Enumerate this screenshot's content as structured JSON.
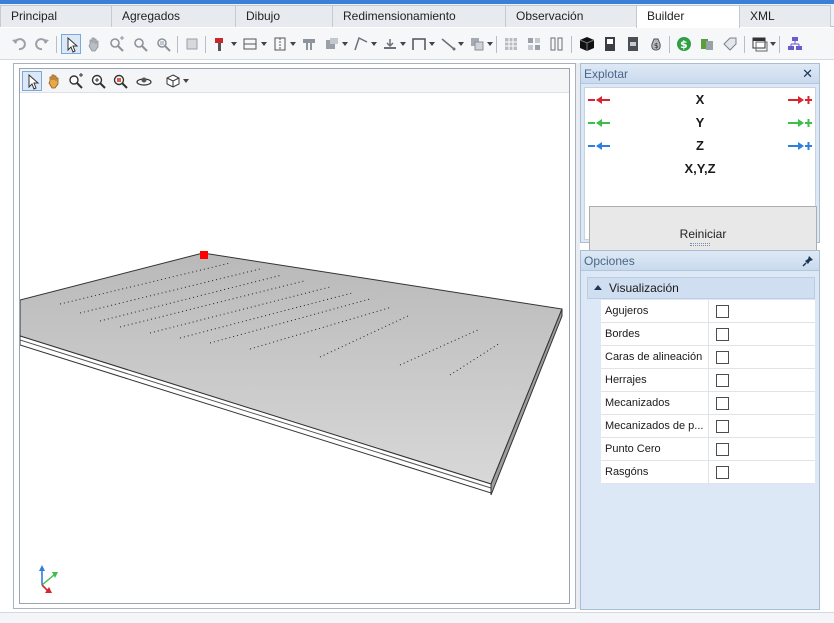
{
  "tabs": [
    {
      "label": "Principal",
      "active": false
    },
    {
      "label": "Agregados",
      "active": false
    },
    {
      "label": "Dibujo",
      "active": false
    },
    {
      "label": "Redimensionamiento",
      "active": false
    },
    {
      "label": "Observación",
      "active": false
    },
    {
      "label": "Builder",
      "active": true
    },
    {
      "label": "XML",
      "active": false
    }
  ],
  "toolbar_icons": [
    "undo-icon",
    "redo-icon",
    "select-icon",
    "pan-icon",
    "zoom-icon",
    "zoom-window-icon",
    "zoom-extents-icon",
    "cut-icon",
    "tool-icon",
    "panel-layout-icon",
    "frame-icon",
    "hardware-icon",
    "stack-icon",
    "measure-icon",
    "dimension-icon",
    "bracket-icon",
    "line-icon",
    "copy-icon",
    "grid-icon",
    "pattern-icon",
    "columns-icon",
    "cube-icon",
    "cabinet-icon",
    "box-icon",
    "money-bag-icon",
    "dollar-icon",
    "color-icon",
    "tag-icon",
    "window-icon",
    "tree-icon"
  ],
  "viewport_icons": [
    "select-icon",
    "pan-icon",
    "zoom-icon",
    "zoom-in-icon",
    "zoom-window-icon",
    "orbit-icon",
    "view-cube-icon"
  ],
  "explode": {
    "title": "Explotar",
    "axes": [
      "X",
      "Y",
      "Z",
      "X,Y,Z"
    ],
    "reset_label": "Reiniciar"
  },
  "options": {
    "title": "Opciones",
    "group": "Visualización",
    "items": [
      {
        "label": "Agujeros",
        "checked": false
      },
      {
        "label": "Bordes",
        "checked": false
      },
      {
        "label": "Caras de alineación",
        "checked": false
      },
      {
        "label": "Herrajes",
        "checked": false
      },
      {
        "label": "Mecanizados",
        "checked": false
      },
      {
        "label": "Mecanizados de p...",
        "checked": false
      },
      {
        "label": "Punto Cero",
        "checked": false
      },
      {
        "label": "Rasgóns",
        "checked": false
      }
    ]
  },
  "colors": {
    "accent": "#3b7fd6",
    "x_axis": "#d9262e",
    "y_axis": "#3cbf4a",
    "z_axis": "#2f7fe0",
    "marker": "#ff0000"
  }
}
